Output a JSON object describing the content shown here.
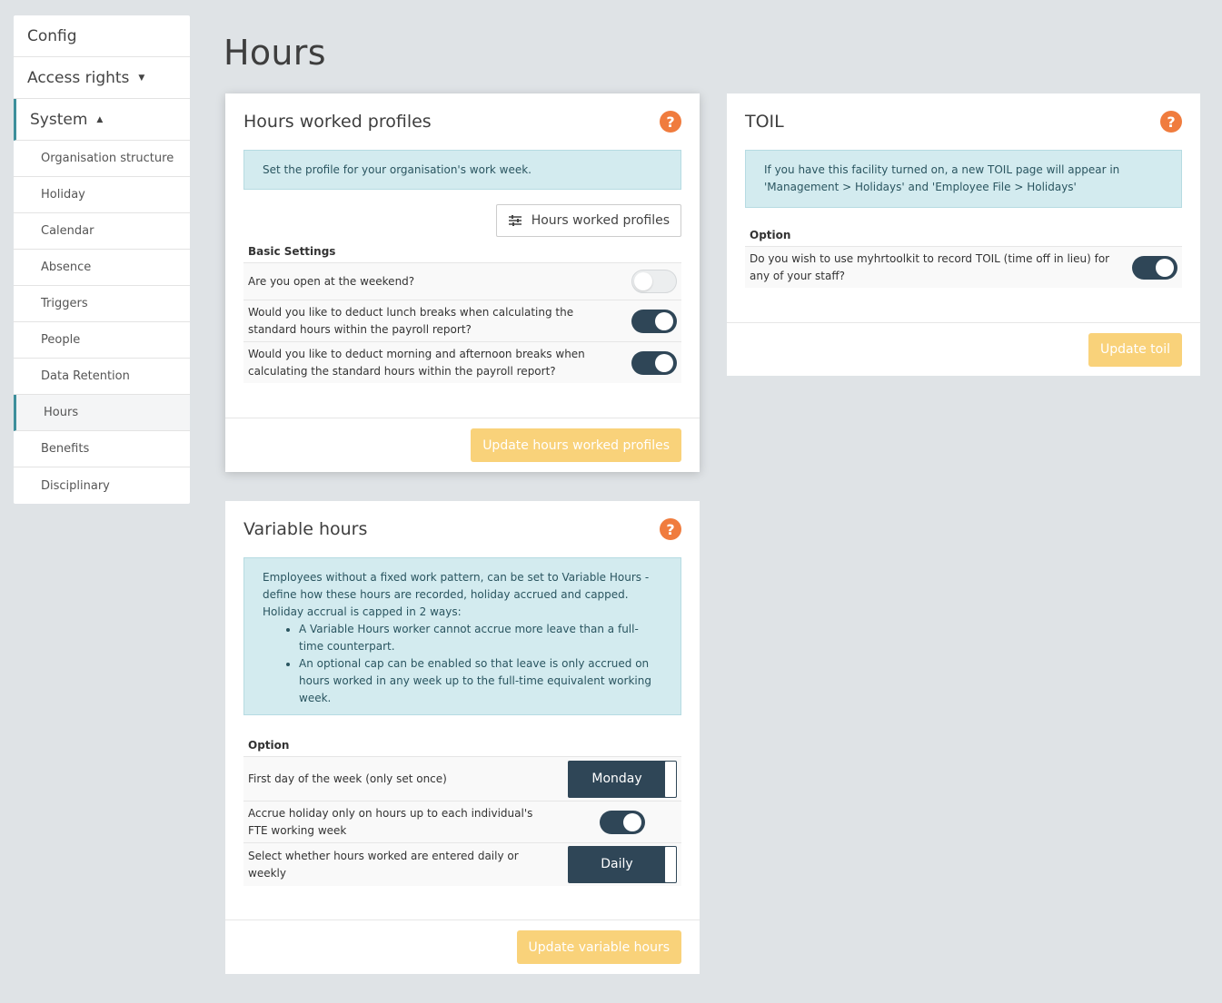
{
  "sidebar": {
    "config": "Config",
    "access_rights": "Access rights",
    "system": "System",
    "items": [
      {
        "label": "Organisation structure"
      },
      {
        "label": "Holiday"
      },
      {
        "label": "Calendar"
      },
      {
        "label": "Absence"
      },
      {
        "label": "Triggers"
      },
      {
        "label": "People"
      },
      {
        "label": "Data Retention"
      },
      {
        "label": "Hours"
      },
      {
        "label": "Benefits"
      },
      {
        "label": "Disciplinary"
      }
    ]
  },
  "page_title": "Hours",
  "hours_profiles": {
    "title": "Hours worked profiles",
    "info": "Set the profile for your organisation's work week.",
    "profiles_button": "Hours worked profiles",
    "section_label": "Basic Settings",
    "rows": [
      {
        "text": "Are you open at the weekend?",
        "state": "off"
      },
      {
        "text": "Would you like to deduct lunch breaks when calculating the standard hours within the payroll report?",
        "state": "on"
      },
      {
        "text": "Would you like to deduct morning and afternoon breaks when calculating the standard hours within the payroll report?",
        "state": "on"
      }
    ],
    "update_button": "Update hours worked profiles"
  },
  "toil": {
    "title": "TOIL",
    "info": "If you have this facility turned on, a new TOIL page will appear in 'Management > Holidays' and 'Employee File > Holidays'",
    "section_label": "Option",
    "row_text": "Do you wish to use myhrtoolkit to record TOIL (time off in lieu) for any of your staff?",
    "row_state": "on",
    "update_button": "Update toil"
  },
  "variable_hours": {
    "title": "Variable hours",
    "info_intro": "Employees without a fixed work pattern, can be set to Variable Hours - define how these hours are recorded, holiday accrued and capped. Holiday accrual is capped in 2 ways:",
    "info_points": [
      "A Variable Hours worker cannot accrue more leave than a full-time counterpart.",
      "An optional cap can be enabled so that leave is only accrued on hours worked in any week up to the full-time equivalent working week."
    ],
    "section_label": "Option",
    "first_day_label": "First day of the week (only set once)",
    "first_day_value": "Monday",
    "accrue_label": "Accrue holiday only on hours up to each individual's FTE working week",
    "accrue_state": "on",
    "entry_label": "Select whether hours worked are entered daily or weekly",
    "entry_value": "Daily",
    "update_button": "Update variable hours"
  },
  "colors": {
    "accent": "#3d8f9b",
    "dark": "#2f4657",
    "help": "#f07c3e",
    "button": "#f9d27a",
    "info_bg": "#d3ebef"
  }
}
